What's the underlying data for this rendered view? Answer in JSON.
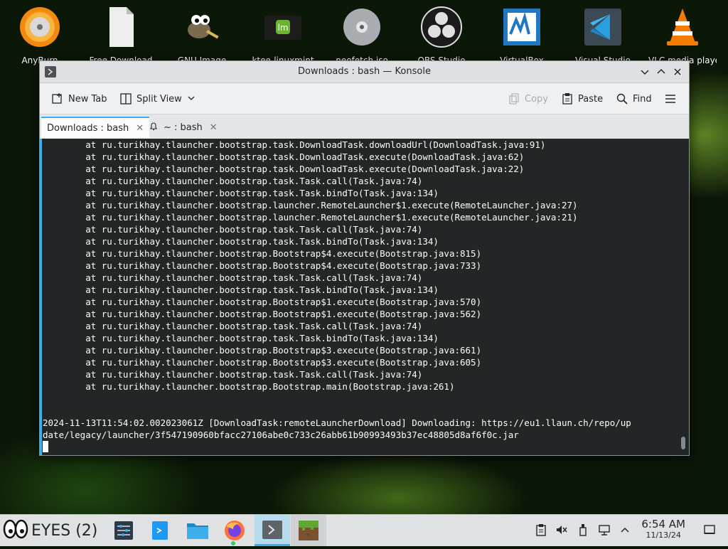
{
  "desktop": {
    "icons": [
      {
        "label": "AnyBurn",
        "icon": "anyburn-disc-icon"
      },
      {
        "label": "Free Download",
        "icon": "document-file-icon"
      },
      {
        "label": "GNU Image",
        "icon": "gimp-icon"
      },
      {
        "label": "ktee-linuxmint",
        "icon": "linux-mint-icon"
      },
      {
        "label": "neofetch.iso",
        "icon": "optical-disc-icon"
      },
      {
        "label": "OBS Studio",
        "icon": "obs-icon"
      },
      {
        "label": "VirtualBox",
        "icon": "virtualbox-icon"
      },
      {
        "label": "Visual Studio",
        "icon": "vscode-icon"
      },
      {
        "label": "VLC media player",
        "icon": "vlc-icon"
      }
    ]
  },
  "window": {
    "title": "Downloads : bash — Konsole",
    "toolbar": {
      "new_tab": "New Tab",
      "split_view": "Split View",
      "copy": "Copy",
      "paste": "Paste",
      "find": "Find"
    },
    "tabs": [
      {
        "label": "Downloads : bash",
        "active": true
      },
      {
        "label": "~ : bash",
        "active": false
      }
    ],
    "terminal": {
      "lines": [
        "        at ru.turikhay.tlauncher.bootstrap.task.DownloadTask.downloadUrl(DownloadTask.java:91)",
        "        at ru.turikhay.tlauncher.bootstrap.task.DownloadTask.execute(DownloadTask.java:62)",
        "        at ru.turikhay.tlauncher.bootstrap.task.DownloadTask.execute(DownloadTask.java:22)",
        "        at ru.turikhay.tlauncher.bootstrap.task.Task.call(Task.java:74)",
        "        at ru.turikhay.tlauncher.bootstrap.task.Task.bindTo(Task.java:134)",
        "        at ru.turikhay.tlauncher.bootstrap.launcher.RemoteLauncher$1.execute(RemoteLauncher.java:27)",
        "        at ru.turikhay.tlauncher.bootstrap.launcher.RemoteLauncher$1.execute(RemoteLauncher.java:21)",
        "        at ru.turikhay.tlauncher.bootstrap.task.Task.call(Task.java:74)",
        "        at ru.turikhay.tlauncher.bootstrap.task.Task.bindTo(Task.java:134)",
        "        at ru.turikhay.tlauncher.bootstrap.Bootstrap$4.execute(Bootstrap.java:815)",
        "        at ru.turikhay.tlauncher.bootstrap.Bootstrap$4.execute(Bootstrap.java:733)",
        "        at ru.turikhay.tlauncher.bootstrap.task.Task.call(Task.java:74)",
        "        at ru.turikhay.tlauncher.bootstrap.task.Task.bindTo(Task.java:134)",
        "        at ru.turikhay.tlauncher.bootstrap.Bootstrap$1.execute(Bootstrap.java:570)",
        "        at ru.turikhay.tlauncher.bootstrap.Bootstrap$1.execute(Bootstrap.java:562)",
        "        at ru.turikhay.tlauncher.bootstrap.task.Task.call(Task.java:74)",
        "        at ru.turikhay.tlauncher.bootstrap.task.Task.bindTo(Task.java:134)",
        "        at ru.turikhay.tlauncher.bootstrap.Bootstrap$3.execute(Bootstrap.java:661)",
        "        at ru.turikhay.tlauncher.bootstrap.Bootstrap$3.execute(Bootstrap.java:605)",
        "        at ru.turikhay.tlauncher.bootstrap.task.Task.call(Task.java:74)",
        "        at ru.turikhay.tlauncher.bootstrap.Bootstrap.main(Bootstrap.java:261)",
        "",
        "",
        "2024-11-13T11:54:02.002023061Z [DownloadTask:remoteLauncherDownload] Downloading: https://eu1.llaun.ch/repo/up",
        "date/legacy/launcher/3f547190960bfacc27106abe0c733c26abb61b90993493b37ec48805d8af6f0c.jar"
      ]
    }
  },
  "taskbar": {
    "activity_label": "EYES (2)",
    "time": "6:54 AM",
    "date": "11/13/24",
    "tasks": [
      "mixer-icon",
      "kde-connect-icon",
      "file-manager-icon",
      "firefox-icon",
      "konsole-icon",
      "minecraft-icon"
    ],
    "tray": [
      "clipboard-icon",
      "volume-muted-icon",
      "usb-device-icon",
      "network-icon",
      "tray-expand-icon",
      "show-desktop-icon"
    ]
  }
}
